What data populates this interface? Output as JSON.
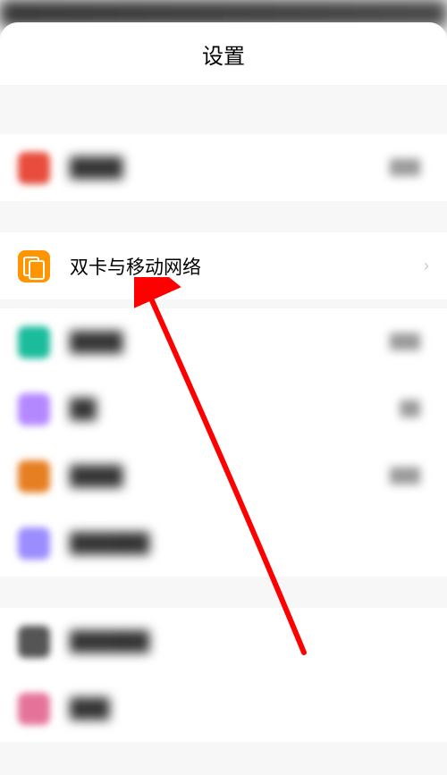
{
  "header": {
    "title": "设置"
  },
  "items": {
    "dualSim": {
      "label": "双卡与移动网络"
    }
  },
  "annotation": {
    "arrowColor": "#ff0000"
  }
}
